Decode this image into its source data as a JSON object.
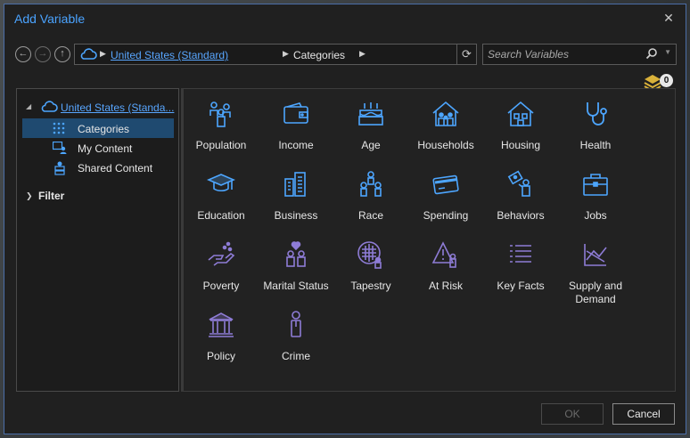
{
  "window": {
    "title": "Add Variable"
  },
  "breadcrumb": {
    "root": "United States (Standard)",
    "current": "Categories"
  },
  "search": {
    "placeholder": "Search Variables"
  },
  "badge": {
    "count": "0"
  },
  "tree": {
    "root_label": "United States (Standa...",
    "items": [
      {
        "label": "Categories",
        "icon": "grid-icon",
        "selected": true
      },
      {
        "label": "My Content",
        "icon": "my-content-icon",
        "selected": false
      },
      {
        "label": "Shared Content",
        "icon": "shared-content-icon",
        "selected": false
      }
    ],
    "filter_label": "Filter"
  },
  "categories": [
    {
      "label": "Population",
      "icon": "population-icon"
    },
    {
      "label": "Income",
      "icon": "wallet-icon"
    },
    {
      "label": "Age",
      "icon": "birthday-cake-icon"
    },
    {
      "label": "Households",
      "icon": "household-icon"
    },
    {
      "label": "Housing",
      "icon": "house-icon"
    },
    {
      "label": "Health",
      "icon": "stethoscope-icon"
    },
    {
      "label": "Education",
      "icon": "graduation-cap-icon"
    },
    {
      "label": "Business",
      "icon": "buildings-icon"
    },
    {
      "label": "Race",
      "icon": "people-icon"
    },
    {
      "label": "Spending",
      "icon": "credit-card-icon"
    },
    {
      "label": "Behaviors",
      "icon": "behaviors-icon"
    },
    {
      "label": "Jobs",
      "icon": "briefcase-icon"
    },
    {
      "label": "Poverty",
      "icon": "hand-coins-icon"
    },
    {
      "label": "Marital Status",
      "icon": "heart-couple-icon"
    },
    {
      "label": "Tapestry",
      "icon": "tapestry-icon"
    },
    {
      "label": "At Risk",
      "icon": "warning-icon"
    },
    {
      "label": "Key Facts",
      "icon": "list-icon"
    },
    {
      "label": "Supply and Demand",
      "icon": "supply-demand-icon"
    },
    {
      "label": "Policy",
      "icon": "government-icon"
    },
    {
      "label": "Crime",
      "icon": "person-icon"
    }
  ],
  "buttons": {
    "ok": "OK",
    "cancel": "Cancel"
  },
  "colors": {
    "accent": "#58a6ff",
    "icon_blue": "#4da6ff",
    "icon_purple": "#8e7cd6",
    "selected_bg": "#1f4a70"
  }
}
